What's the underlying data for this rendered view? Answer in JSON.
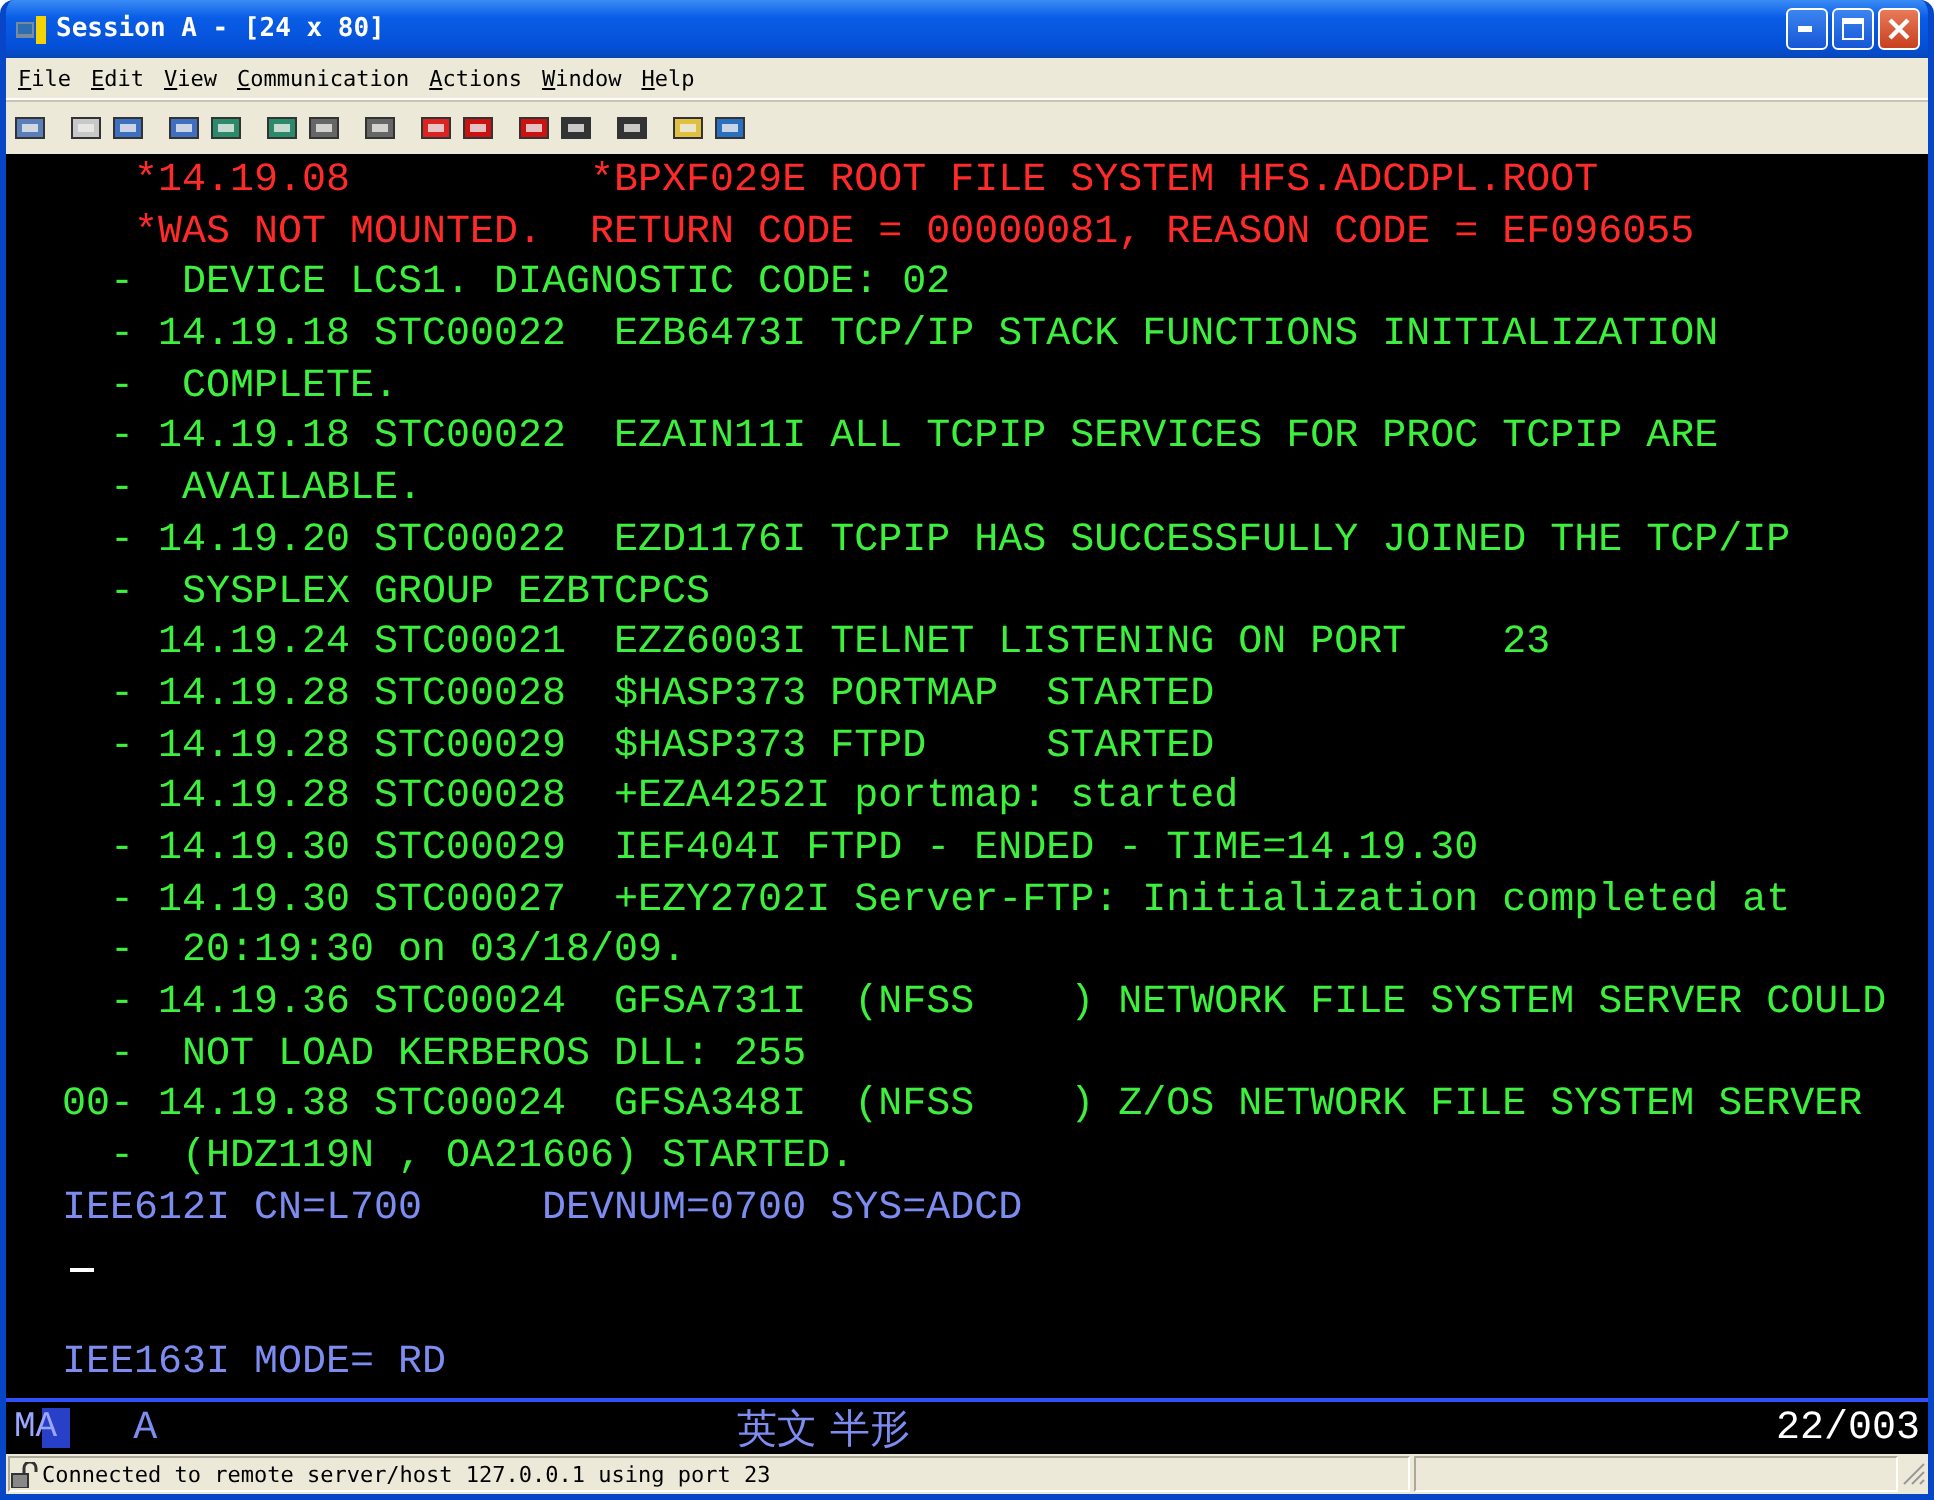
{
  "window": {
    "title": "Session A - [24 x 80]"
  },
  "menu": [
    "File",
    "Edit",
    "View",
    "Communication",
    "Actions",
    "Window",
    "Help"
  ],
  "screen": {
    "lines": [
      {
        "kind": "alert",
        "text": "     *14.19.08          *BPXF029E ROOT FILE SYSTEM HFS.ADCDPL.ROOT"
      },
      {
        "kind": "alert",
        "text": "     *WAS NOT MOUNTED.  RETURN CODE = 00000081, REASON CODE = EF096055"
      },
      {
        "kind": "normal",
        "text": "    -  DEVICE LCS1. DIAGNOSTIC CODE: 02"
      },
      {
        "kind": "normal",
        "text": "    - 14.19.18 STC00022  EZB6473I TCP/IP STACK FUNCTIONS INITIALIZATION"
      },
      {
        "kind": "normal",
        "text": "    -  COMPLETE."
      },
      {
        "kind": "normal",
        "text": "    - 14.19.18 STC00022  EZAIN11I ALL TCPIP SERVICES FOR PROC TCPIP ARE"
      },
      {
        "kind": "normal",
        "text": "    -  AVAILABLE."
      },
      {
        "kind": "normal",
        "text": "    - 14.19.20 STC00022  EZD1176I TCPIP HAS SUCCESSFULLY JOINED THE TCP/IP"
      },
      {
        "kind": "normal",
        "text": "    -  SYSPLEX GROUP EZBTCPCS"
      },
      {
        "kind": "normal",
        "text": "      14.19.24 STC00021  EZZ6003I TELNET LISTENING ON PORT    23"
      },
      {
        "kind": "normal",
        "text": "    - 14.19.28 STC00028  $HASP373 PORTMAP  STARTED"
      },
      {
        "kind": "normal",
        "text": "    - 14.19.28 STC00029  $HASP373 FTPD     STARTED"
      },
      {
        "kind": "normal",
        "text": "      14.19.28 STC00028  +EZA4252I portmap: started"
      },
      {
        "kind": "normal",
        "text": "    - 14.19.30 STC00029  IEF404I FTPD - ENDED - TIME=14.19.30"
      },
      {
        "kind": "normal",
        "text": "    - 14.19.30 STC00027  +EZY2702I Server-FTP: Initialization completed at"
      },
      {
        "kind": "normal",
        "text": "    -  20:19:30 on 03/18/09."
      },
      {
        "kind": "normal",
        "text": "    - 14.19.36 STC00024  GFSA731I  (NFSS    ) NETWORK FILE SYSTEM SERVER COULD"
      },
      {
        "kind": "normal",
        "text": "    -  NOT LOAD KERBEROS DLL: 255"
      },
      {
        "kind": "normal",
        "text": "  00- 14.19.38 STC00024  GFSA348I  (NFSS    ) Z/OS NETWORK FILE SYSTEM SERVER"
      },
      {
        "kind": "normal",
        "text": "    -  (HDZ119N , OA21606) STARTED."
      },
      {
        "kind": "info",
        "text": "  IEE612I CN=L700     DEVNUM=0700 SYS=ADCD"
      },
      {
        "kind": "cursor"
      },
      {
        "kind": "blank"
      },
      {
        "kind": "info",
        "text": "  IEE163I MODE= RD"
      }
    ]
  },
  "oia": {
    "session_indicator": "MA",
    "connection": "A",
    "input_mode": "英文 半形",
    "cursor_position": "22/003"
  },
  "status_bar": {
    "message": "Connected to remote server/host 127.0.0.1 using port 23"
  }
}
